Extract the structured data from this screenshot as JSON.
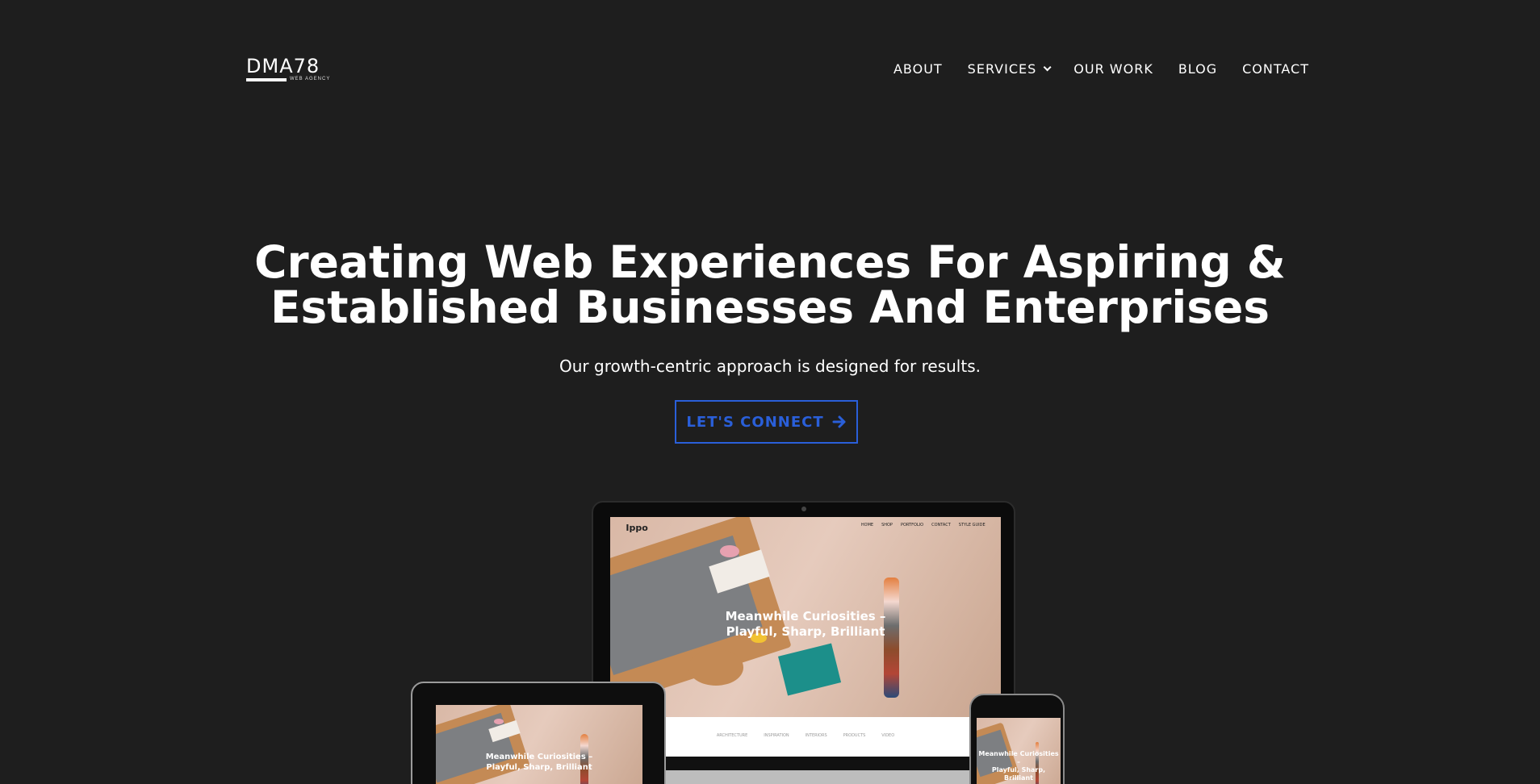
{
  "brand": {
    "logo_text": "DMA78",
    "logo_subtext": "WEB AGENCY"
  },
  "nav": {
    "items": [
      {
        "label": "ABOUT",
        "has_dropdown": false
      },
      {
        "label": "SERVICES",
        "has_dropdown": true
      },
      {
        "label": "OUR WORK",
        "has_dropdown": false
      },
      {
        "label": "BLOG",
        "has_dropdown": false
      },
      {
        "label": "CONTACT",
        "has_dropdown": false
      }
    ]
  },
  "hero": {
    "title_line1": "Creating Web Experiences For Aspiring &",
    "title_line2": "Established Businesses And Enterprises",
    "subtitle": "Our growth-centric approach is designed for results.",
    "cta_label": "LET'S CONNECT",
    "cta_icon": "arrow-right-icon"
  },
  "mockup": {
    "site_logo": "Ippo",
    "site_nav": [
      "HOME",
      "SHOP",
      "PORTFOLIO",
      "CONTACT",
      "STYLE GUIDE"
    ],
    "headline_line1": "Meanwhile Curiosities –",
    "headline_line2": "Playful, Sharp, Brilliant",
    "strip_links": [
      "ARCHITECTURE",
      "INSPIRATION",
      "INTERIORS",
      "PRODUCTS",
      "VIDEO"
    ]
  },
  "colors": {
    "background": "#1e1e1e",
    "text": "#ffffff",
    "accent": "#2a5fd9"
  }
}
